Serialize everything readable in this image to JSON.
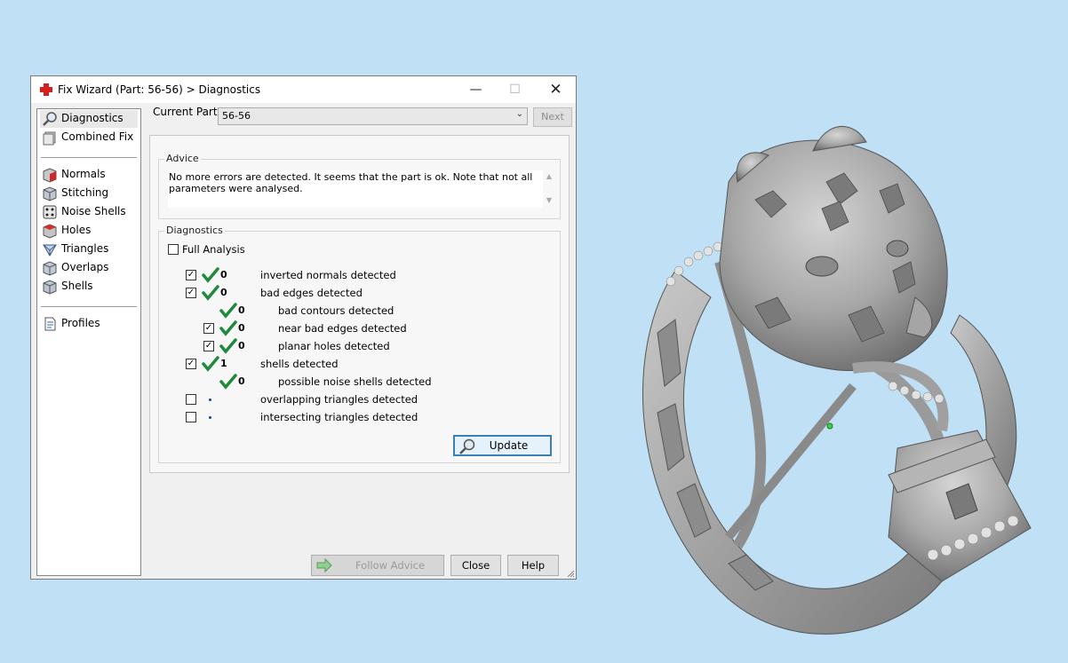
{
  "window": {
    "title": "Fix Wizard (Part: 56-56) > Diagnostics",
    "min_glyph": "—",
    "max_glyph": "☐",
    "close_glyph": "✕"
  },
  "sidebar": {
    "items": [
      {
        "label": "Diagnostics",
        "icon": "magnifier-icon"
      },
      {
        "label": "Combined Fix",
        "icon": "box-stack-icon"
      },
      {
        "label": "Normals",
        "icon": "normals-cube-icon"
      },
      {
        "label": "Stitching",
        "icon": "stitching-cube-icon"
      },
      {
        "label": "Noise Shells",
        "icon": "dice-icon"
      },
      {
        "label": "Holes",
        "icon": "holes-cube-icon"
      },
      {
        "label": "Triangles",
        "icon": "triangles-icon"
      },
      {
        "label": "Overlaps",
        "icon": "overlaps-cube-icon"
      },
      {
        "label": "Shells",
        "icon": "shells-cube-icon"
      },
      {
        "label": "Profiles",
        "icon": "document-icon"
      }
    ]
  },
  "current_part": {
    "label": "Current Part:",
    "value": "56-56",
    "next": "Next"
  },
  "advice": {
    "title": "Advice",
    "text": "No more errors are detected. It seems that the part is ok. Note that not all parameters were analysed."
  },
  "diagnostics": {
    "title": "Diagnostics",
    "full_analysis": "Full Analysis",
    "rows": [
      {
        "count": "0",
        "text": "inverted normals detected",
        "checked": true
      },
      {
        "count": "0",
        "text": "bad edges detected",
        "checked": true
      },
      {
        "count": "0",
        "text": "bad contours detected",
        "checked": null
      },
      {
        "count": "0",
        "text": "near bad edges detected",
        "checked": true
      },
      {
        "count": "0",
        "text": "planar holes detected",
        "checked": true
      },
      {
        "count": "1",
        "text": "shells detected",
        "checked": true
      },
      {
        "count": "0",
        "text": "possible noise shells detected",
        "checked": null
      },
      {
        "count": "",
        "text": "overlapping triangles detected",
        "checked": false
      },
      {
        "count": "",
        "text": "intersecting triangles detected",
        "checked": false
      }
    ],
    "update": "Update"
  },
  "footer": {
    "follow": "Follow Advice",
    "close": "Close",
    "help": "Help"
  },
  "colors": {
    "background": "#bfe0f5",
    "check_green": "#1f8a3a",
    "accent": "#3c7fb1"
  }
}
